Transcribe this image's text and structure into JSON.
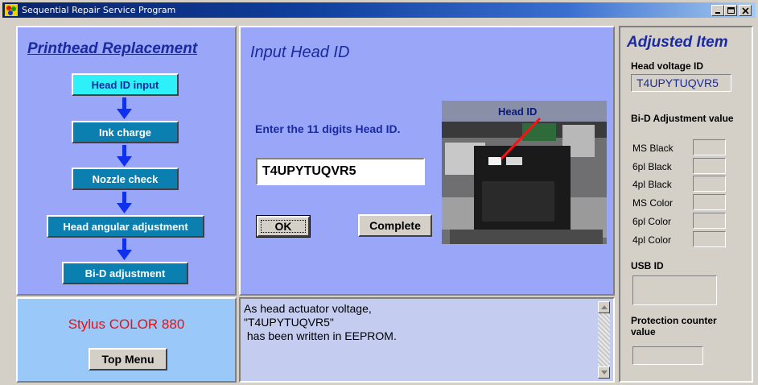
{
  "window": {
    "title": "Sequential Repair Service Program"
  },
  "flow": {
    "title": "Printhead Replacement",
    "steps": [
      {
        "label": "Head ID input",
        "active": true
      },
      {
        "label": "Ink charge",
        "active": false
      },
      {
        "label": "Nozzle check",
        "active": false
      },
      {
        "label": "Head angular adjustment",
        "active": false
      },
      {
        "label": "Bi-D adjustment",
        "active": false
      }
    ]
  },
  "input": {
    "title": "Input Head ID",
    "prompt": "Enter the 11 digits Head ID.",
    "head_id_value": "T4UPYTUQVR5",
    "ok_label": "OK",
    "complete_label": "Complete",
    "photo_label": "Head ID"
  },
  "message": {
    "text": "As head actuator voltage,\n\"T4UPYTUQVR5\"\n has been written in EEPROM."
  },
  "model": {
    "name": "Stylus COLOR 880",
    "top_menu_label": "Top Menu"
  },
  "adjusted": {
    "title": "Adjusted Item",
    "head_voltage_label": "Head voltage ID",
    "head_voltage_value": "T4UPYTUQVR5",
    "bid_label": "Bi-D Adjustment value",
    "bid_rows": [
      "MS Black",
      "6pl Black",
      "4pl Black",
      "MS Color",
      "6pl Color",
      "4pl Color"
    ],
    "usb_label": "USB ID",
    "protection_label": "Protection counter value"
  },
  "colors": {
    "panel_blue": "#9aa6f8",
    "step_button": "#0a7fb0",
    "step_active": "#2ef0f8",
    "heading_blue": "#1a2aa0",
    "model_red": "#e81010"
  },
  "icons": [
    "app-icon",
    "minimize-icon",
    "maximize-icon",
    "close-icon",
    "arrow-down-icon",
    "scroll-up-icon",
    "scroll-down-icon"
  ]
}
